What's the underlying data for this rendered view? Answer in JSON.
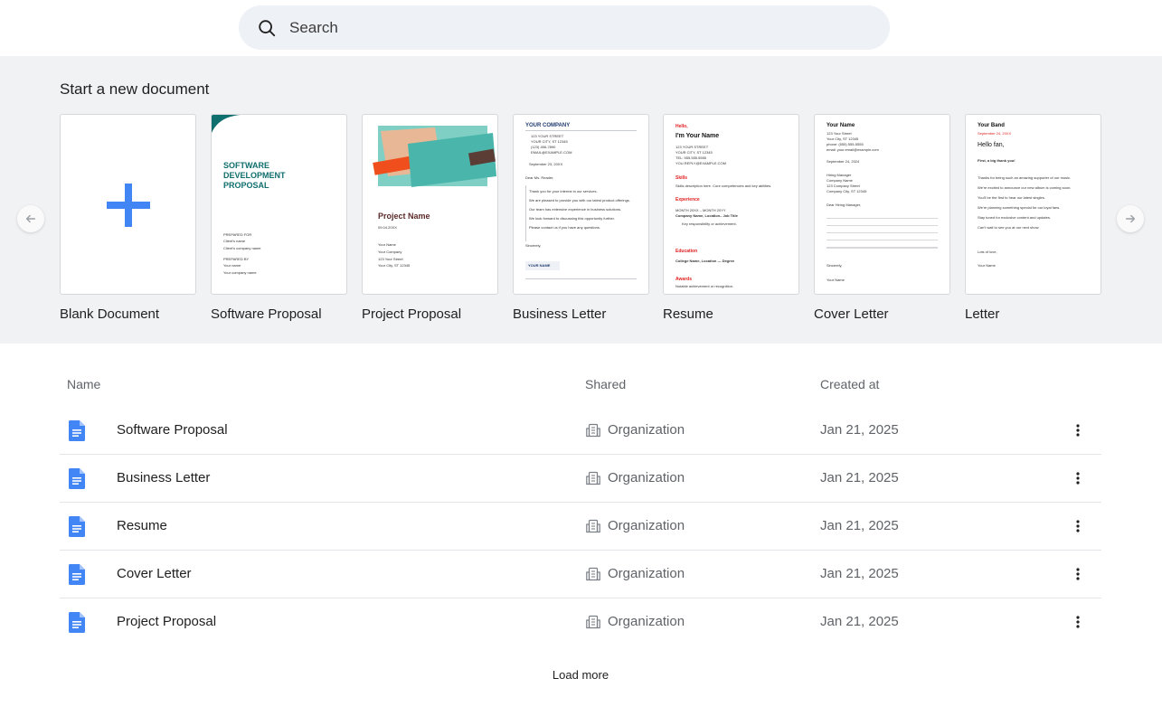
{
  "search": {
    "placeholder": "Search"
  },
  "templates": {
    "heading": "Start a new document",
    "items": [
      {
        "label": "Blank Document"
      },
      {
        "label": "Software Proposal",
        "preview": {
          "title": "SOFTWARE DEVELOPMENT PROPOSAL",
          "prepared_for": "PREPARED FOR",
          "client_name": "Client's name",
          "client_company": "Client's company name",
          "prepared_by": "PREPARED BY",
          "your_name": "Your name",
          "your_company": "Your company name"
        }
      },
      {
        "label": "Project Proposal",
        "preview": {
          "title": "Project Name",
          "date": "09.04.20XX",
          "lines": [
            "Your Name",
            "Your Company",
            "123 Your Street",
            "Your City, ST 12345"
          ]
        }
      },
      {
        "label": "Business Letter",
        "preview": {
          "company": "YOUR COMPANY",
          "address": [
            "123 YOUR STREET",
            "YOUR CITY, ST 12345",
            "(123) 456-7890",
            "EMAIL@EXAMPLE.COM"
          ],
          "date": "September 23, 20XX",
          "greeting": "Dear Ms. Reader,",
          "body": [
            "Thank you for your interest in our services.",
            "We are pleased to provide you with our latest product offerings.",
            "Our team has extensive experience in business solutions.",
            "We look forward to discussing this opportunity further.",
            "Please contact us if you have any questions."
          ],
          "closing": "Sincerely,",
          "sign": "YOUR NAME"
        }
      },
      {
        "label": "Resume",
        "preview": {
          "hello": "Hello,",
          "name": "I'm Your Name",
          "address": [
            "123 YOUR STREET",
            "YOUR CITY, ST 12345",
            "TEL: 555.555.5555",
            "YOU.REPLY@EXAMPLE.COM"
          ],
          "skills_h": "Skills",
          "skills": "Skills description here. Core competencies and key abilities.",
          "exp_h": "Experience",
          "exp_date": "MONTH 20XX – MONTH 20YY",
          "exp_title": "Company Name, Location– Job Title",
          "exp_item": "Key responsibility or achievement.",
          "edu_h": "Education",
          "edu": "College Name, Location — Degree",
          "awards_h": "Awards",
          "awards": "Notable achievement or recognition."
        }
      },
      {
        "label": "Cover Letter",
        "preview": {
          "name": "Your Name",
          "lines": [
            "123 Your Street",
            "Your City, ST 12345",
            "phone: (555) 555-5555",
            "email: your.email@example.com"
          ],
          "date": "September 24, 2024",
          "recipient": [
            "Hiring Manager",
            "Company Name",
            "123 Company Street",
            "Company City, ST 12345"
          ],
          "greeting": "Dear Hiring Manager,",
          "closing": "Sincerely,",
          "sign": "Your Name"
        }
      },
      {
        "label": "Letter",
        "preview": {
          "band": "Your Band",
          "date": "September 24, 20XX",
          "hello": "Hello fan,",
          "thanks": "First, a big thank you!",
          "body": [
            "Thanks for being such an amazing supporter of our music.",
            "We're excited to announce our new album is coming soon.",
            "You'll be the first to hear our latest singles.",
            "We're planning something special for our loyal fans.",
            "Stay tuned for exclusive content and updates.",
            "Can't wait to see you at our next show."
          ],
          "closing": "Lots of love,",
          "sign": "Your Name"
        }
      }
    ]
  },
  "table": {
    "headers": {
      "name": "Name",
      "shared": "Shared",
      "created": "Created at"
    },
    "rows": [
      {
        "name": "Software Proposal",
        "shared": "Organization",
        "created": "Jan 21, 2025"
      },
      {
        "name": "Business Letter",
        "shared": "Organization",
        "created": "Jan 21, 2025"
      },
      {
        "name": "Resume",
        "shared": "Organization",
        "created": "Jan 21, 2025"
      },
      {
        "name": "Cover Letter",
        "shared": "Organization",
        "created": "Jan 21, 2025"
      },
      {
        "name": "Project Proposal",
        "shared": "Organization",
        "created": "Jan 21, 2025"
      }
    ]
  },
  "load_more": "Load more",
  "colors": {
    "accent": "#4285f4",
    "teal": "#0f6e6e",
    "red": "#e02020",
    "panel": "#f1f2f4"
  }
}
